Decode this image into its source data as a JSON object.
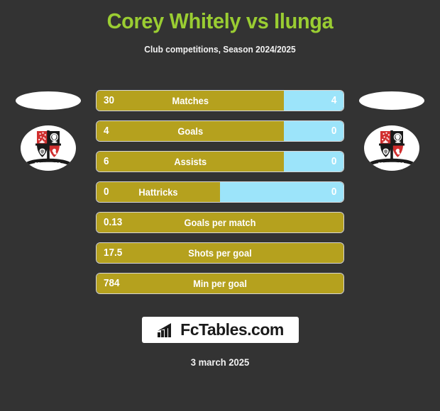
{
  "header": {
    "title": "Corey Whitely vs Ilunga",
    "subtitle": "Club competitions, Season 2024/2025"
  },
  "colors": {
    "background": "#333333",
    "title_green": "#9ACD32",
    "bar_gold": "#B5A11E",
    "bar_blue": "#9CE4FA",
    "text_white": "#FFFFFF"
  },
  "teams": {
    "left_badge": "bromley-fc-crest",
    "right_badge": "bromley-fc-crest",
    "badge_banner_text": "BROMLEY F.C."
  },
  "stats": [
    {
      "label": "Matches",
      "left": "30",
      "right": "4",
      "left_pct": 76,
      "right_pct": 24,
      "has_right": true
    },
    {
      "label": "Goals",
      "left": "4",
      "right": "0",
      "left_pct": 76,
      "right_pct": 24,
      "has_right": true
    },
    {
      "label": "Assists",
      "left": "6",
      "right": "0",
      "left_pct": 76,
      "right_pct": 24,
      "has_right": true
    },
    {
      "label": "Hattricks",
      "left": "0",
      "right": "0",
      "left_pct": 50,
      "right_pct": 50,
      "has_right": true
    },
    {
      "label": "Goals per match",
      "left": "0.13",
      "right": "",
      "left_pct": 100,
      "right_pct": 0,
      "has_right": false
    },
    {
      "label": "Shots per goal",
      "left": "17.5",
      "right": "",
      "left_pct": 100,
      "right_pct": 0,
      "has_right": false
    },
    {
      "label": "Min per goal",
      "left": "784",
      "right": "",
      "left_pct": 100,
      "right_pct": 0,
      "has_right": false
    }
  ],
  "footer": {
    "logo_text": "FcTables.com",
    "logo_icon": "bar-chart-growth-icon",
    "date": "3 march 2025"
  },
  "chart_data": {
    "type": "bar",
    "title": "Corey Whitely vs Ilunga",
    "subtitle": "Club competitions, Season 2024/2025",
    "orientation": "horizontal-diverging",
    "categories": [
      "Matches",
      "Goals",
      "Assists",
      "Hattricks",
      "Goals per match",
      "Shots per goal",
      "Min per goal"
    ],
    "series": [
      {
        "name": "Corey Whitely",
        "color": "#B5A11E",
        "values": [
          30,
          4,
          6,
          0,
          0.13,
          17.5,
          784
        ]
      },
      {
        "name": "Ilunga",
        "color": "#9CE4FA",
        "values": [
          4,
          0,
          0,
          0,
          null,
          null,
          null
        ]
      }
    ],
    "legend": "none",
    "grid": false
  }
}
